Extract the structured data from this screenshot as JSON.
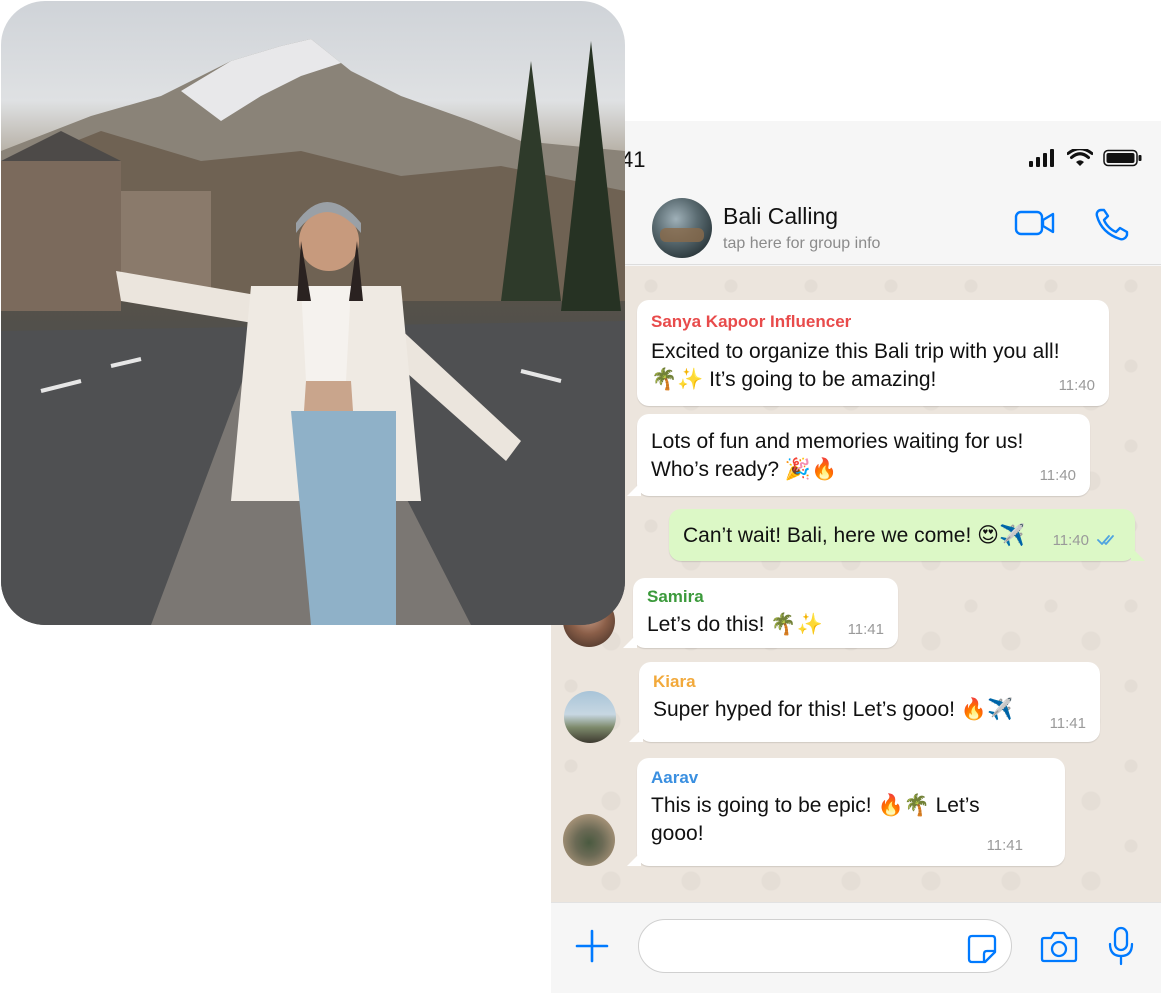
{
  "status_bar": {
    "time": "41"
  },
  "chat": {
    "title": "Bali Calling",
    "subtitle": "tap here for group info"
  },
  "messages": [
    {
      "sender": "Sanya Kapoor Influencer",
      "sender_color": "#e84b4b",
      "text": "Excited to organize this Bali trip with you all!\n🌴✨ It’s going to be amazing!",
      "time": "11:40",
      "direction": "in"
    },
    {
      "sender": "",
      "text": "Lots of fun and memories waiting for us!\nWho’s ready? 🎉🔥",
      "time": "11:40",
      "direction": "in"
    },
    {
      "sender": "",
      "text": "Can’t wait! Bali, here we come! 😍✈️",
      "time": "11:40",
      "direction": "out",
      "status": "read"
    },
    {
      "sender": "Samira",
      "sender_color": "#3c9a3c",
      "text": "Let’s do this! 🌴✨",
      "time": "11:41",
      "direction": "in"
    },
    {
      "sender": "Kiara",
      "sender_color": "#f2a93b",
      "text": "Super hyped for this! Let’s gooo! 🔥✈️",
      "time": "11:41",
      "direction": "in"
    },
    {
      "sender": "Aarav",
      "sender_color": "#3a8fe0",
      "text": "This is going to be epic! 🔥🌴 Let’s\ngooo!",
      "time": "11:41",
      "direction": "in"
    }
  ],
  "composer": {
    "placeholder": ""
  },
  "colors": {
    "accent": "#007aff",
    "outgoing_bubble": "#dcf8c6",
    "chat_background": "#ece5dd",
    "read_ticks": "#4fa3e0"
  },
  "icons": [
    "signal-icon",
    "wifi-icon",
    "battery-icon",
    "video-call-icon",
    "phone-call-icon",
    "plus-icon",
    "sticker-icon",
    "camera-icon",
    "microphone-icon",
    "double-check-icon"
  ]
}
